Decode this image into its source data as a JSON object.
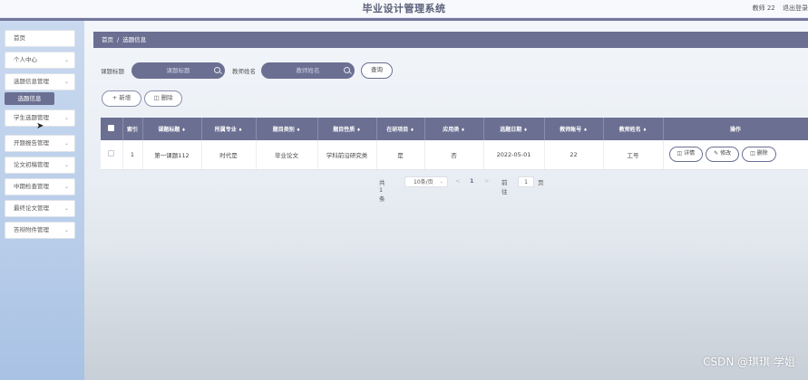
{
  "header": {
    "title": "毕业设计管理系统",
    "user": "教师 22",
    "logout": "退出登录"
  },
  "sidebar": {
    "items": [
      {
        "label": "首页",
        "has_submenu": false
      },
      {
        "label": "个人中心",
        "has_submenu": true
      },
      {
        "label": "选题信息管理",
        "has_submenu": true
      },
      {
        "label": "学生选题管理",
        "has_submenu": true
      },
      {
        "label": "开题报告管理",
        "has_submenu": true
      },
      {
        "label": "论文初稿管理",
        "has_submenu": true
      },
      {
        "label": "中期检查管理",
        "has_submenu": true
      },
      {
        "label": "最终论文管理",
        "has_submenu": true
      },
      {
        "label": "答辩附件管理",
        "has_submenu": true
      }
    ],
    "active_subitem": "选题信息"
  },
  "breadcrumb": {
    "home": "首页",
    "separator": "/",
    "current": "选题信息"
  },
  "search": {
    "title_label": "课题标题",
    "title_placeholder": "课题标题",
    "teacher_label": "教师姓名",
    "teacher_placeholder": "教师姓名",
    "query_button": "查询"
  },
  "actions": {
    "add": "+ 新增",
    "delete": "删除"
  },
  "table": {
    "columns": [
      "索引",
      "课题标题",
      "所属专业",
      "题目类别",
      "题目性质",
      "在研项目",
      "应用类",
      "选题日期",
      "教师账号",
      "教师姓名",
      "操作"
    ],
    "rows": [
      {
        "index": "1",
        "title": "第一课题112",
        "major": "时代是",
        "category": "毕业论文",
        "nature": "学科前沿研究类",
        "research_project": "是",
        "applied": "否",
        "date": "2022-05-01",
        "teacher_account": "22",
        "teacher_name": "工号"
      }
    ],
    "row_actions": [
      "详情",
      "修改",
      "删除"
    ]
  },
  "pagination": {
    "total": "共 1 条",
    "page_size": "10条/页",
    "current_page": "1",
    "goto_label": "前往",
    "goto_value": "1",
    "page_suffix": "页"
  },
  "watermark": "CSDN @琪琪 学姐",
  "colors": {
    "primary": "#6b6f92",
    "header_band": "#73779c",
    "sidebar": "#b8cde9"
  }
}
